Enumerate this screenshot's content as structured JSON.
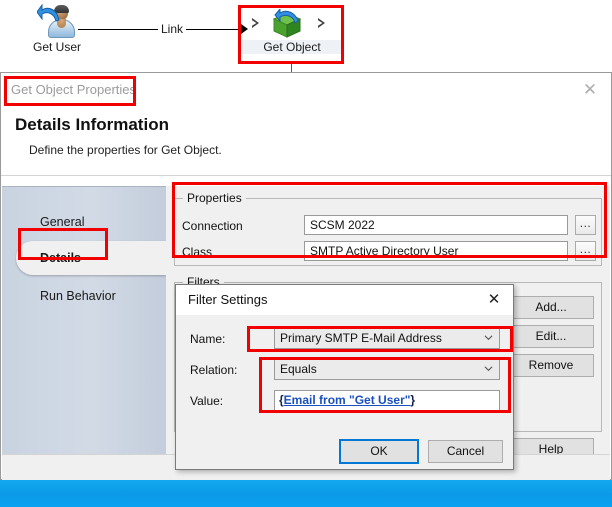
{
  "workflow": {
    "nodes": [
      {
        "label": "Get User",
        "icon": "person-arrow-icon",
        "selected": false
      },
      {
        "label": "Get Object",
        "icon": "green-cube-arrow-icon",
        "selected": true
      }
    ],
    "link_label": "Link"
  },
  "dialog": {
    "title": "Get Object Properties",
    "close_label": "✕",
    "heading": "Details Information",
    "subheading": "Define the properties for Get Object.",
    "nav": [
      {
        "label": "General",
        "active": false
      },
      {
        "label": "Details",
        "active": true
      },
      {
        "label": "Run Behavior",
        "active": false
      }
    ],
    "properties": {
      "group_title": "Properties",
      "connection_label": "Connection",
      "connection_value": "SCSM 2022",
      "class_label": "Class",
      "class_value": "SMTP Active Directory User",
      "browse_label": "..."
    },
    "filters": {
      "group_title": "Filters",
      "add_label": "Add...",
      "edit_label": "Edit...",
      "remove_label": "Remove"
    },
    "help_label": "Help"
  },
  "filter_settings": {
    "title": "Filter Settings",
    "close_label": "✕",
    "name_label": "Name:",
    "name_value": "Primary SMTP E-Mail Address",
    "relation_label": "Relation:",
    "relation_value": "Equals",
    "value_label": "Value:",
    "value_open_brace": "{",
    "value_token": "Email from \"Get User\"",
    "value_close_brace": "}",
    "ok_label": "OK",
    "cancel_label": "Cancel"
  },
  "annotations": {
    "accent_color": "#f20000",
    "focus_color": "#0078d7"
  }
}
